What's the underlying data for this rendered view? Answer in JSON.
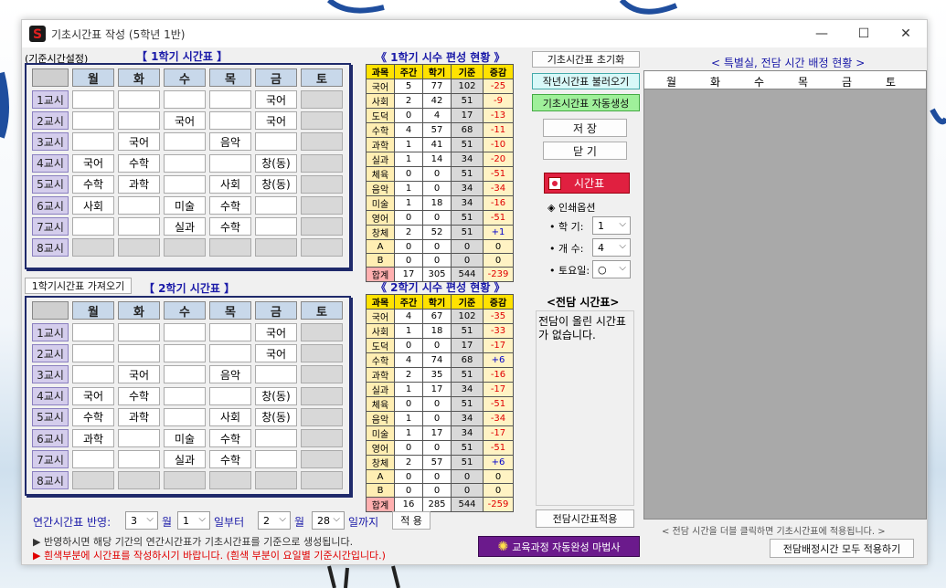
{
  "window": {
    "title": "기초시간표 작성 (5학년 1반)",
    "minimize": "—",
    "maximize": "☐",
    "close": "✕"
  },
  "basis_label": "(기준시간설정)",
  "sem1": {
    "title": "【 1학기 시간표 】"
  },
  "sem2": {
    "title": "【 2학기 시간표 】",
    "import_button": "1학기시간표 가져오기"
  },
  "days": [
    "월",
    "화",
    "수",
    "목",
    "금",
    "토"
  ],
  "periods": [
    "1교시",
    "2교시",
    "3교시",
    "4교시",
    "5교시",
    "6교시",
    "7교시",
    "8교시"
  ],
  "sem1_rows": [
    [
      "",
      "",
      "",
      "",
      "국어",
      ""
    ],
    [
      "",
      "",
      "국어",
      "",
      "국어",
      ""
    ],
    [
      "",
      "국어",
      "",
      "음악",
      "",
      ""
    ],
    [
      "국어",
      "수학",
      "",
      "",
      "창(동)",
      ""
    ],
    [
      "수학",
      "과학",
      "",
      "사회",
      "창(동)",
      ""
    ],
    [
      "사회",
      "",
      "미술",
      "수학",
      "",
      ""
    ],
    [
      "",
      "",
      "실과",
      "수학",
      "",
      ""
    ],
    [
      "",
      "",
      "",
      "",
      "",
      ""
    ]
  ],
  "sem2_rows": [
    [
      "",
      "",
      "",
      "",
      "국어",
      ""
    ],
    [
      "",
      "",
      "",
      "",
      "국어",
      ""
    ],
    [
      "",
      "국어",
      "",
      "음악",
      "",
      ""
    ],
    [
      "국어",
      "수학",
      "",
      "",
      "창(동)",
      ""
    ],
    [
      "수학",
      "과학",
      "",
      "사회",
      "창(동)",
      ""
    ],
    [
      "과학",
      "",
      "미술",
      "수학",
      "",
      ""
    ],
    [
      "",
      "",
      "실과",
      "수학",
      "",
      ""
    ],
    [
      "",
      "",
      "",
      "",
      "",
      ""
    ]
  ],
  "stats1": {
    "title": "《 1학기 시수 편성 현황 》",
    "headers": [
      "과목",
      "주간",
      "학기",
      "기준",
      "증감"
    ],
    "rows": [
      [
        "국어",
        "5",
        "77",
        "102",
        "-25"
      ],
      [
        "사회",
        "2",
        "42",
        "51",
        "-9"
      ],
      [
        "도덕",
        "0",
        "4",
        "17",
        "-13"
      ],
      [
        "수학",
        "4",
        "57",
        "68",
        "-11"
      ],
      [
        "과학",
        "1",
        "41",
        "51",
        "-10"
      ],
      [
        "실과",
        "1",
        "14",
        "34",
        "-20"
      ],
      [
        "체육",
        "0",
        "0",
        "51",
        "-51"
      ],
      [
        "음악",
        "1",
        "0",
        "34",
        "-34"
      ],
      [
        "미술",
        "1",
        "18",
        "34",
        "-16"
      ],
      [
        "영어",
        "0",
        "0",
        "51",
        "-51"
      ],
      [
        "창체",
        "2",
        "52",
        "51",
        "+1"
      ],
      [
        "A",
        "0",
        "0",
        "0",
        "0"
      ],
      [
        "B",
        "0",
        "0",
        "0",
        "0"
      ]
    ],
    "total": [
      "합계",
      "17",
      "305",
      "544",
      "-239"
    ]
  },
  "stats2": {
    "title": "《 2학기 시수 편성 현황 》",
    "headers": [
      "과목",
      "주간",
      "학기",
      "기준",
      "증감"
    ],
    "rows": [
      [
        "국어",
        "4",
        "67",
        "102",
        "-35"
      ],
      [
        "사회",
        "1",
        "18",
        "51",
        "-33"
      ],
      [
        "도덕",
        "0",
        "0",
        "17",
        "-17"
      ],
      [
        "수학",
        "4",
        "74",
        "68",
        "+6"
      ],
      [
        "과학",
        "2",
        "35",
        "51",
        "-16"
      ],
      [
        "실과",
        "1",
        "17",
        "34",
        "-17"
      ],
      [
        "체육",
        "0",
        "0",
        "51",
        "-51"
      ],
      [
        "음악",
        "1",
        "0",
        "34",
        "-34"
      ],
      [
        "미술",
        "1",
        "17",
        "34",
        "-17"
      ],
      [
        "영어",
        "0",
        "0",
        "51",
        "-51"
      ],
      [
        "창체",
        "2",
        "57",
        "51",
        "+6"
      ],
      [
        "A",
        "0",
        "0",
        "0",
        "0"
      ],
      [
        "B",
        "0",
        "0",
        "0",
        "0"
      ]
    ],
    "total": [
      "합계",
      "16",
      "285",
      "544",
      "-259"
    ]
  },
  "buttons": {
    "reset": "기초시간표 초기화",
    "load_last_year": "작년시간표 불러오기",
    "auto_generate": "기초시간표 자동생성",
    "save": "저 장",
    "close": "닫 기",
    "timetable": "시간표",
    "apply_homeroom": "전담시간표적용",
    "apply": "적 용",
    "wizard": "교육과정 자동완성 마법사",
    "apply_all": "전담배정시간 모두 적용하기"
  },
  "print": {
    "title": "◈ 인쇄옵션",
    "semester_label": "• 학 기:",
    "semester_value": "1",
    "count_label": "• 개 수:",
    "count_value": "4",
    "saturday_label": "• 토요일:",
    "saturday_value": "○"
  },
  "homeroom": {
    "title": "<전담 시간표>",
    "message": "전담이 올린 시간표가 없습니다."
  },
  "special": {
    "title": "< 특별실, 전담 시간 배정 현황 >",
    "headers": [
      "월",
      "화",
      "수",
      "목",
      "금",
      "토"
    ],
    "hint": "< 전담 시간을 더블 클릭하면 기초시간표에 적용됩니다. >"
  },
  "annual": {
    "label": "연간시간표 반영:",
    "month1": "3",
    "unit_month": "월",
    "day1": "1",
    "from": "일부터",
    "month2": "2",
    "day2": "28",
    "until": "일까지"
  },
  "notes": {
    "note1": "▶ 반영하시면 해당 기간의 연간시간표가 기초시간표를 기준으로 생성됩니다.",
    "note2": "▶ 흰색부분에 시간표를 작성하시기 바랍니다. (흰색 부분이 요일별 기준시간입니다.)"
  },
  "colors": {
    "accent": "#1a1aa8",
    "stat_header": "#ffe200",
    "wizard": "#6b1a8c",
    "timetable_btn": "#e02040"
  }
}
